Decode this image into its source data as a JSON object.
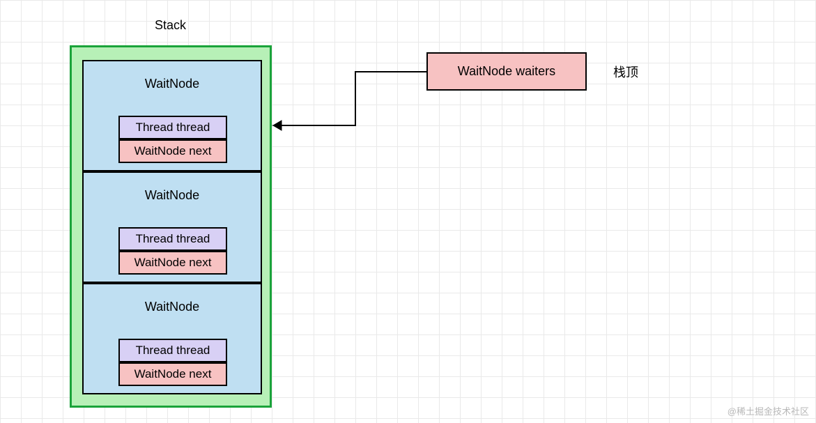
{
  "title": "Stack",
  "stack": {
    "nodes": [
      {
        "label": "WaitNode",
        "thread": "Thread thread",
        "next": "WaitNode next"
      },
      {
        "label": "WaitNode",
        "thread": "Thread thread",
        "next": "WaitNode next"
      },
      {
        "label": "WaitNode",
        "thread": "Thread thread",
        "next": "WaitNode next"
      }
    ]
  },
  "waiters": {
    "label": "WaitNode waiters"
  },
  "stack_top_label": "栈顶",
  "watermark": "@稀土掘金技术社区"
}
